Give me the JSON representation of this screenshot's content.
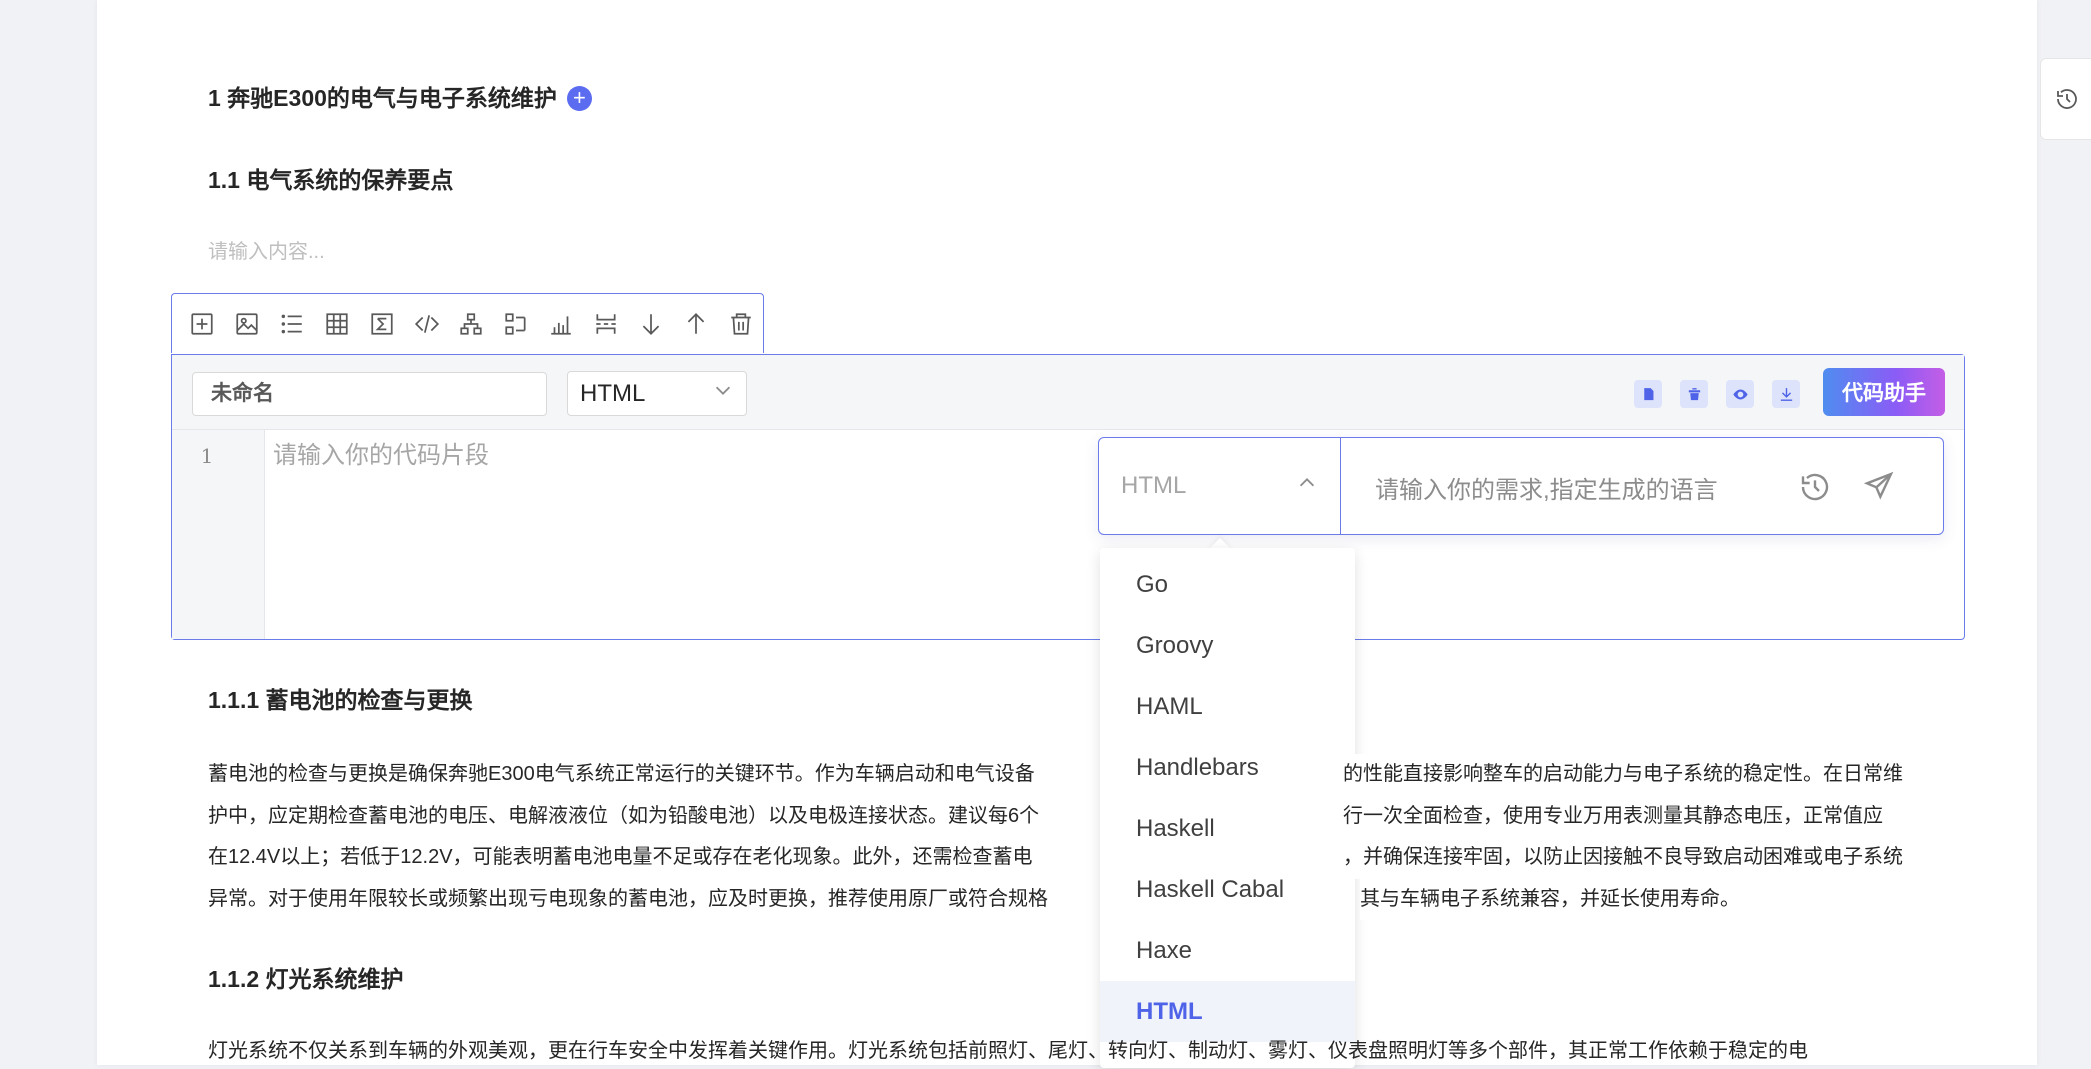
{
  "document": {
    "heading1": "1 奔驰E300的电气与电子系统维护",
    "heading2": "1.1 电气系统的保养要点",
    "content_placeholder": "请输入内容...",
    "heading3_1": "1.1.1 蓄电池的检查与更换",
    "paragraph1_lines": [
      "蓄电池的检查与更换是确保奔驰E300电气系统正常运行的关键环节。作为车辆启动和电气设备",
      "护中，应定期检查蓄电池的电压、电解液液位（如为铅酸电池）以及电极连接状态。建议每6个",
      "在12.4V以上；若低于12.2V，可能表明蓄电池电量不足或存在老化现象。此外，还需检查蓄电",
      "异常。对于使用年限较长或频繁出现亏电现象的蓄电池，应及时更换，推荐使用原厂或符合规格"
    ],
    "paragraph1_lines_right": [
      "的性能直接影响整车的启动能力与电子系统的稳定性。在日常维",
      "行一次全面检查，使用专业万用表测量其静态电压，正常值应",
      "，并确保连接牢固，以防止因接触不良导致启动困难或电子系统",
      "其与车辆电子系统兼容，并延长使用寿命。"
    ],
    "heading3_2": "1.1.2 灯光系统维护",
    "paragraph2_line": "灯光系统不仅关系到车辆的外观美观，更在行车安全中发挥着关键作用。灯光系统包括前照灯、尾灯、转向灯、制动灯、雾灯、仪表盘照明灯等多个部件，其正常工作依赖于稳定的电"
  },
  "toolbar": {
    "icons": [
      "add-block-icon",
      "image-icon",
      "list-icon",
      "table-icon",
      "formula-icon",
      "code-icon",
      "org-chart-icon",
      "flow-icon",
      "bar-chart-icon",
      "split-icon",
      "move-down-icon",
      "move-up-icon",
      "delete-icon"
    ]
  },
  "code_block": {
    "name_value": "未命名",
    "language_value": "HTML",
    "line_number": "1",
    "code_placeholder": "请输入你的代码片段",
    "assistant_label": "代码助手"
  },
  "ai_panel": {
    "language_value": "HTML",
    "input_placeholder": "请输入你的需求,指定生成的语言"
  },
  "dropdown": {
    "options": [
      "Go",
      "Groovy",
      "HAML",
      "Handlebars",
      "Haskell",
      "Haskell Cabal",
      "Haxe",
      "HTML"
    ],
    "selected": "HTML"
  },
  "colors": {
    "accent": "#5b6cf0",
    "border": "#6b7bea"
  }
}
